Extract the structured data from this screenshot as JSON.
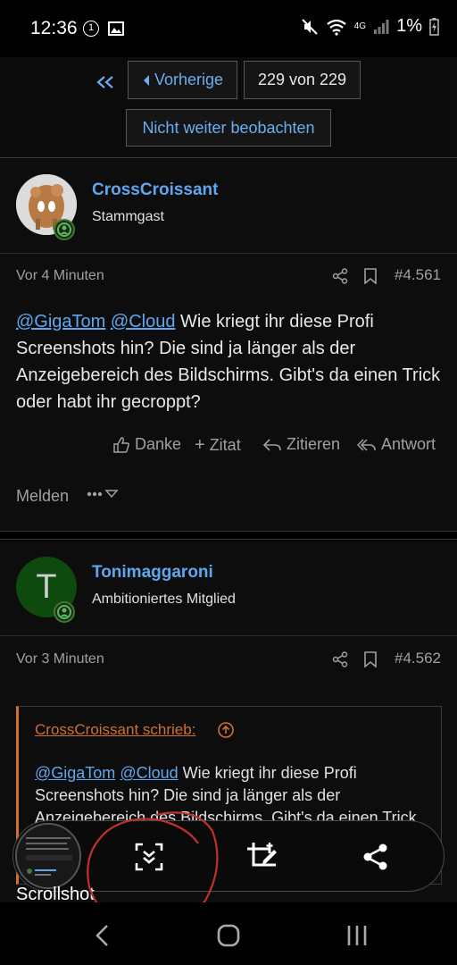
{
  "status_bar": {
    "time": "12:36",
    "notif_count": "1",
    "battery": "1%",
    "network": "4G"
  },
  "pager": {
    "prev_label": "Vorherige",
    "page_label": "229 von 229",
    "unwatch_label": "Nicht weiter beobachten"
  },
  "posts": [
    {
      "username": "CrossCroissant",
      "user_title": "Stammgast",
      "time": "Vor 4 Minuten",
      "number": "#4.561",
      "mention1": "@GigaTom",
      "mention2": "@Cloud",
      "body": " Wie kriegt ihr diese Profi Screenshots hin? Die sind ja länger als der Anzeigebereich des Bildschirms. Gibt's da einen Trick oder habt ihr gecroppt?",
      "actions": {
        "like": "Danke",
        "quote": "Zitat",
        "multiquote": "Zitieren",
        "reply": "Antwort",
        "report": "Melden"
      }
    },
    {
      "username": "Tonimaggaroni",
      "user_title": "Ambitioniertes Mitglied",
      "avatar_letter": "T",
      "time": "Vor 3 Minuten",
      "number": "#4.562",
      "quote_header": "CrossCroissant schrieb:",
      "quote_mention1": "@GigaTom",
      "quote_mention2": "@Cloud",
      "quote_body": " Wie kriegt ihr diese Profi Screenshots hin? Die sind ja länger als der Anzeigebereich des Bildschirms. Gibt's da einen Trick"
    }
  ],
  "toolbar": {
    "scroll_label": "Scrollshot"
  },
  "colors": {
    "accent": "#5fa8f0",
    "quote_accent": "#d07030",
    "annotation": "#c03030"
  }
}
